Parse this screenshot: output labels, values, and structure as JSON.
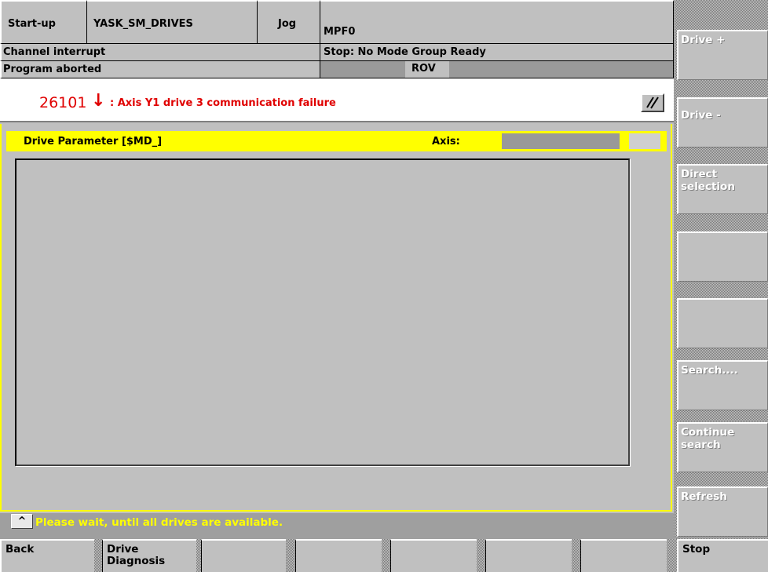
{
  "header": {
    "area": "Start-up",
    "machine": "YASK_SM_DRIVES",
    "mode": "Jog",
    "program": "MPF0",
    "channel_status": "Channel interrupt",
    "stop_status": "Stop: No Mode Group Ready",
    "program_status": "Program aborted",
    "rov": "ROV"
  },
  "alarm": {
    "number": "26101",
    "arrow": "↓",
    "text": ": Axis Y1 drive 3 communication failure",
    "color": "#e00000",
    "ack_icon": "acknowledge-icon"
  },
  "panel": {
    "title": "Drive Parameter [$MD_]",
    "axis_label": "Axis:",
    "axis_value": "",
    "title_bg": "#ffff00"
  },
  "message": {
    "caret": "^",
    "text": "Please wait, until all drives are available.",
    "color": "#ffff00"
  },
  "vertical_softkeys": [
    "Drive +",
    "Drive -",
    "Direct\nselection",
    "",
    "",
    "Search....",
    "Continue\nsearch",
    "Refresh"
  ],
  "horizontal_softkeys": [
    "Back",
    "Drive\nDiagnosis",
    "",
    "",
    "",
    "",
    "",
    "Stop"
  ]
}
